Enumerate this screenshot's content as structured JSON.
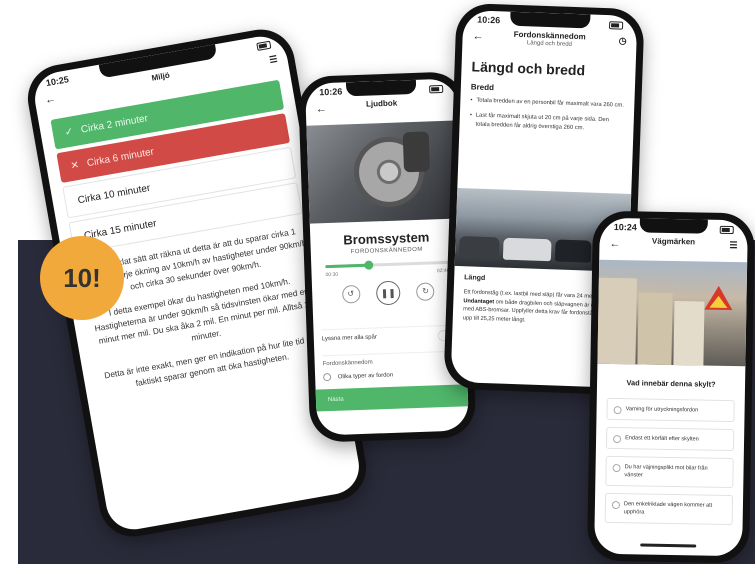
{
  "badge": "10!",
  "phone_miljo": {
    "time": "10:25",
    "title": "Miljö",
    "options": [
      {
        "label": "Cirka 2 minuter",
        "state": "correct",
        "mark": "✓"
      },
      {
        "label": "Cirka 6 minuter",
        "state": "wrong",
        "mark": "✕"
      },
      {
        "label": "Cirka 10 minuter",
        "state": "plain",
        "mark": ""
      },
      {
        "label": "Cirka 15 minuter",
        "state": "plain",
        "mark": ""
      }
    ],
    "explanation": [
      "Ett förenklat sätt att räkna ut detta är att du sparar cirka 1 minut för varje ökning av 10km/h av hastigheter under 90km/h och cirka 30 sekunder över 90km/h.",
      "I detta exempel ökar du hastigheten med 10km/h. Hastigheterna är under 90km/h så tidsvinsten ökar med en minut mer mil. Du ska åka 2 mil. En minut per mil. Alltså 2 minuter.",
      "Detta är inte exakt, men ger en indikation på hur lite tid du faktiskt sparar genom att öka hastigheten."
    ]
  },
  "phone_ljudbok": {
    "time": "10:26",
    "title": "Ljudbok",
    "chapter_title": "Bromssystem",
    "chapter_category": "FORDONSKÄNNEDOM",
    "progress": 0.35,
    "time_elapsed": "00:30",
    "time_total": "02:46",
    "toggle_label": "Lyssna mer alla spår",
    "section_label": "Fordonskännedom",
    "section_item": "Olika typer av fordon",
    "next_label": "Nästa"
  },
  "phone_fordon": {
    "time": "10:26",
    "title": "Fordonskännedom",
    "subtitle": "Längd och bredd",
    "heading": "Längd och bredd",
    "subheading_1": "Bredd",
    "bullets": [
      "Totala bredden av en personbil får maximalt vara 260 cm.",
      "Last får maximalt skjuta ut 20 cm på varje sida. Den totala bredden får aldrig överstiga 260 cm."
    ],
    "subheading_2": "Längd",
    "paragraph_start": "Ett fordonståg (t.ex. lastbil med släp) får vara 24 meter.",
    "paragraph_bold": "Undantaget",
    "paragraph_end": "om både dragbilen och släpvagnen är utrustade med ABS-bromsar. Uppfyller detta krav får fordonståget vara upp till 25,25 meter långt."
  },
  "phone_vagmarken": {
    "time": "10:24",
    "title": "Vägmärken",
    "question": "Vad innebär denna skylt?",
    "choices": [
      "Varning för utryckningsfordon",
      "Endast ett körfält efter skylten",
      "Du har väjningsplikt mot bilar från vänster",
      "Den enkelriktade vägen kommer att upphöra"
    ]
  },
  "colors": {
    "correct": "#4fb66a",
    "wrong": "#d24a45",
    "badge": "#f2a93b",
    "backdrop": "#2a2b3a"
  }
}
